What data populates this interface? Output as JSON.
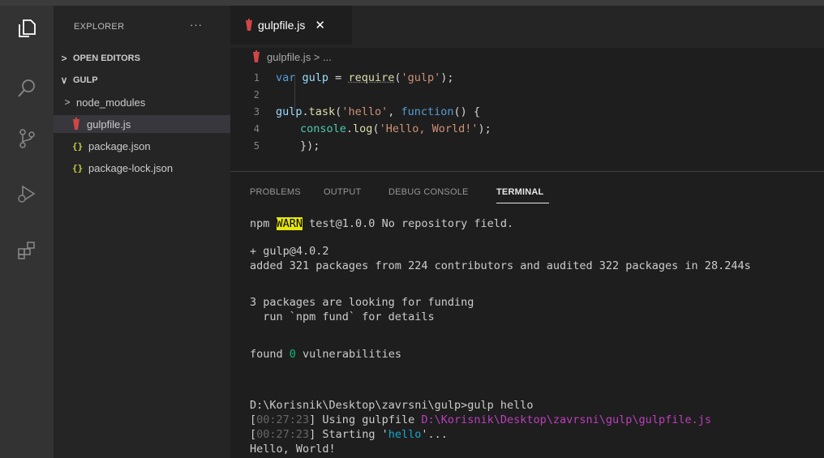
{
  "explorer": {
    "title": "EXPLORER",
    "more": "···",
    "open_editors": "OPEN EDITORS",
    "folder": "GULP",
    "items": [
      {
        "label": "node_modules",
        "kind": "folder"
      },
      {
        "label": "gulpfile.js",
        "kind": "gulp"
      },
      {
        "label": "package.json",
        "kind": "json"
      },
      {
        "label": "package-lock.json",
        "kind": "json"
      }
    ]
  },
  "editor": {
    "tab_label": "gulpfile.js",
    "tab_close": "✕",
    "breadcrumb": "gulpfile.js > ...",
    "lines": [
      {
        "n": "1"
      },
      {
        "n": "2"
      },
      {
        "n": "3"
      },
      {
        "n": "4"
      },
      {
        "n": "5"
      }
    ],
    "code": {
      "l1_var": "var",
      "l1_name": "gulp",
      "l1_eq": " = ",
      "l1_fn": "require",
      "l1_open": "(",
      "l1_str": "'gulp'",
      "l1_close": ");",
      "l3_obj": "gulp",
      "l3_dot": ".",
      "l3_fn": "task",
      "l3_open": "(",
      "l3_str": "'hello'",
      "l3_comma": ", ",
      "l3_kw": "function",
      "l3_rest": "() {",
      "l4_obj": "console",
      "l4_dot": ".",
      "l4_fn": "log",
      "l4_open": "(",
      "l4_str": "'Hello, World!'",
      "l4_close": ");",
      "l5": "});"
    }
  },
  "panel": {
    "tabs": [
      "PROBLEMS",
      "OUTPUT",
      "DEBUG CONSOLE",
      "TERMINAL"
    ],
    "active_tab": "TERMINAL",
    "terminal": {
      "l1_pre": "npm ",
      "l1_warn": "WARN",
      "l1_post": " test@1.0.0 No repository field.",
      "l2": "+ gulp@4.0.2",
      "l3": "added 321 packages from 224 contributors and audited 322 packages in 28.244s",
      "l4": "3 packages are looking for funding",
      "l5": "  run `npm fund` for details",
      "l6_pre": "found ",
      "l6_num": "0",
      "l6_post": " vulnerabilities",
      "l7": "D:\\Korisnik\\Desktop\\zavrsni\\gulp>gulp hello",
      "l8_open": "[",
      "l8_time": "00:27:23",
      "l8_close": "] Using gulpfile ",
      "l8_path": "D:\\Korisnik\\Desktop\\zavrsni\\gulp\\gulpfile.js",
      "l9_open": "[",
      "l9_time": "00:27:23",
      "l9_mid": "] Starting '",
      "l9_task": "hello",
      "l9_end": "'...",
      "l10": "Hello, World!"
    }
  },
  "colors": {
    "warn_bg": "#e5e510",
    "gulp_red": "#cf4647",
    "json_yellow": "#cbcb41"
  }
}
